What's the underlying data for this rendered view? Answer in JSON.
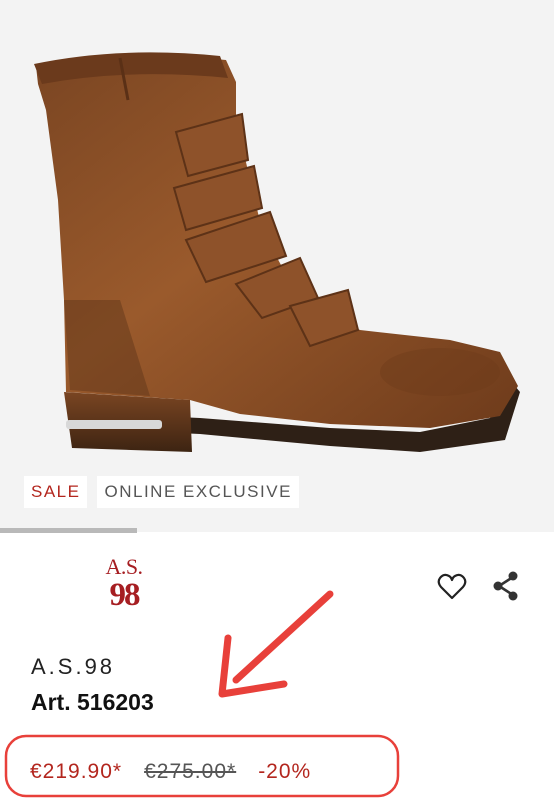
{
  "badges": {
    "sale": "SALE",
    "online_exclusive": "ONLINE EXCLUSIVE"
  },
  "brand_logo": {
    "line1": "A.S.",
    "line2": "98"
  },
  "product": {
    "brand": "A.S.98",
    "article": "Art. 516203"
  },
  "price": {
    "current": "€219.90*",
    "original": "€275.00*",
    "discount": "-20%"
  },
  "icons": {
    "favorite": "heart-icon",
    "share": "share-icon"
  },
  "colors": {
    "accent": "#b3261e",
    "annotation": "#e8403a",
    "boot": "#8a4f25"
  }
}
